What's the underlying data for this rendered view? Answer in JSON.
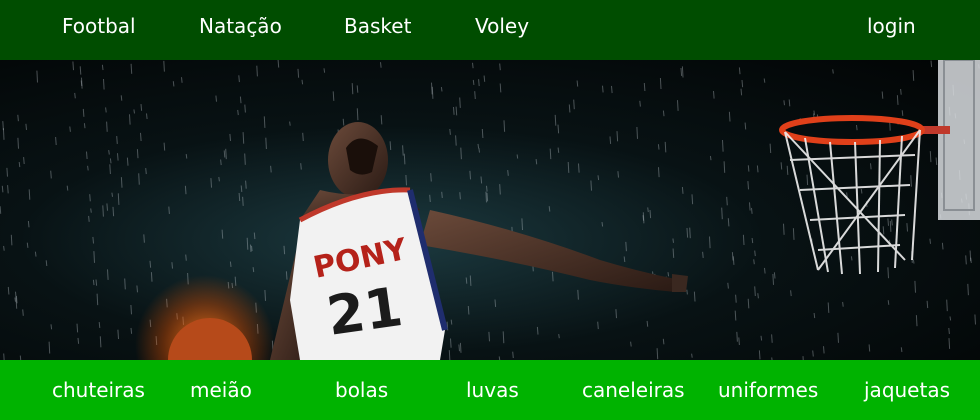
{
  "top_nav": {
    "items": [
      "Footbal",
      "Natação",
      "Basket",
      "Voley"
    ],
    "login_label": "login"
  },
  "hero": {
    "jersey_text": "PONY",
    "jersey_number": "21"
  },
  "bottom_nav": {
    "items": [
      "chuteiras",
      "meião",
      "bolas",
      "luvas",
      "caneleiras",
      "uniformes",
      "jaquetas"
    ]
  },
  "colors": {
    "top_bar": "#004d00",
    "bottom_bar": "#00b300",
    "text": "#ffffff",
    "rim": "#e0401a"
  }
}
